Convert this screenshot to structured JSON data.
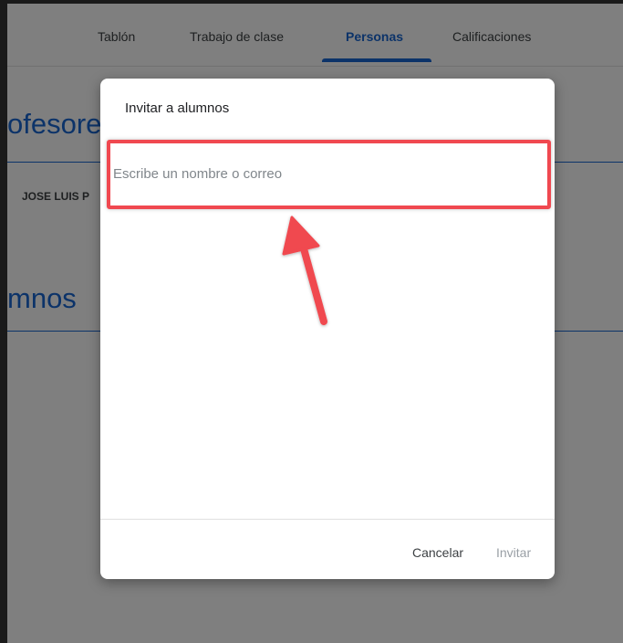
{
  "nav": {
    "tabs": [
      {
        "label": "Tablón",
        "active": false
      },
      {
        "label": "Trabajo de clase",
        "active": false
      },
      {
        "label": "Personas",
        "active": true
      },
      {
        "label": "Calificaciones",
        "active": false
      }
    ]
  },
  "background": {
    "teachers_heading": "ofesore",
    "teacher_name": "JOSE LUIS P",
    "students_heading": "mnos"
  },
  "dialog": {
    "title": "Invitar a alumnos",
    "input_placeholder": "Escribe un nombre o correo",
    "input_value": "",
    "cancel_label": "Cancelar",
    "invite_label": "Invitar",
    "invite_enabled": false
  },
  "colors": {
    "accent": "#1967d2",
    "annotation": "#f04850",
    "scrim": "rgba(0,0,0,0.5)"
  }
}
